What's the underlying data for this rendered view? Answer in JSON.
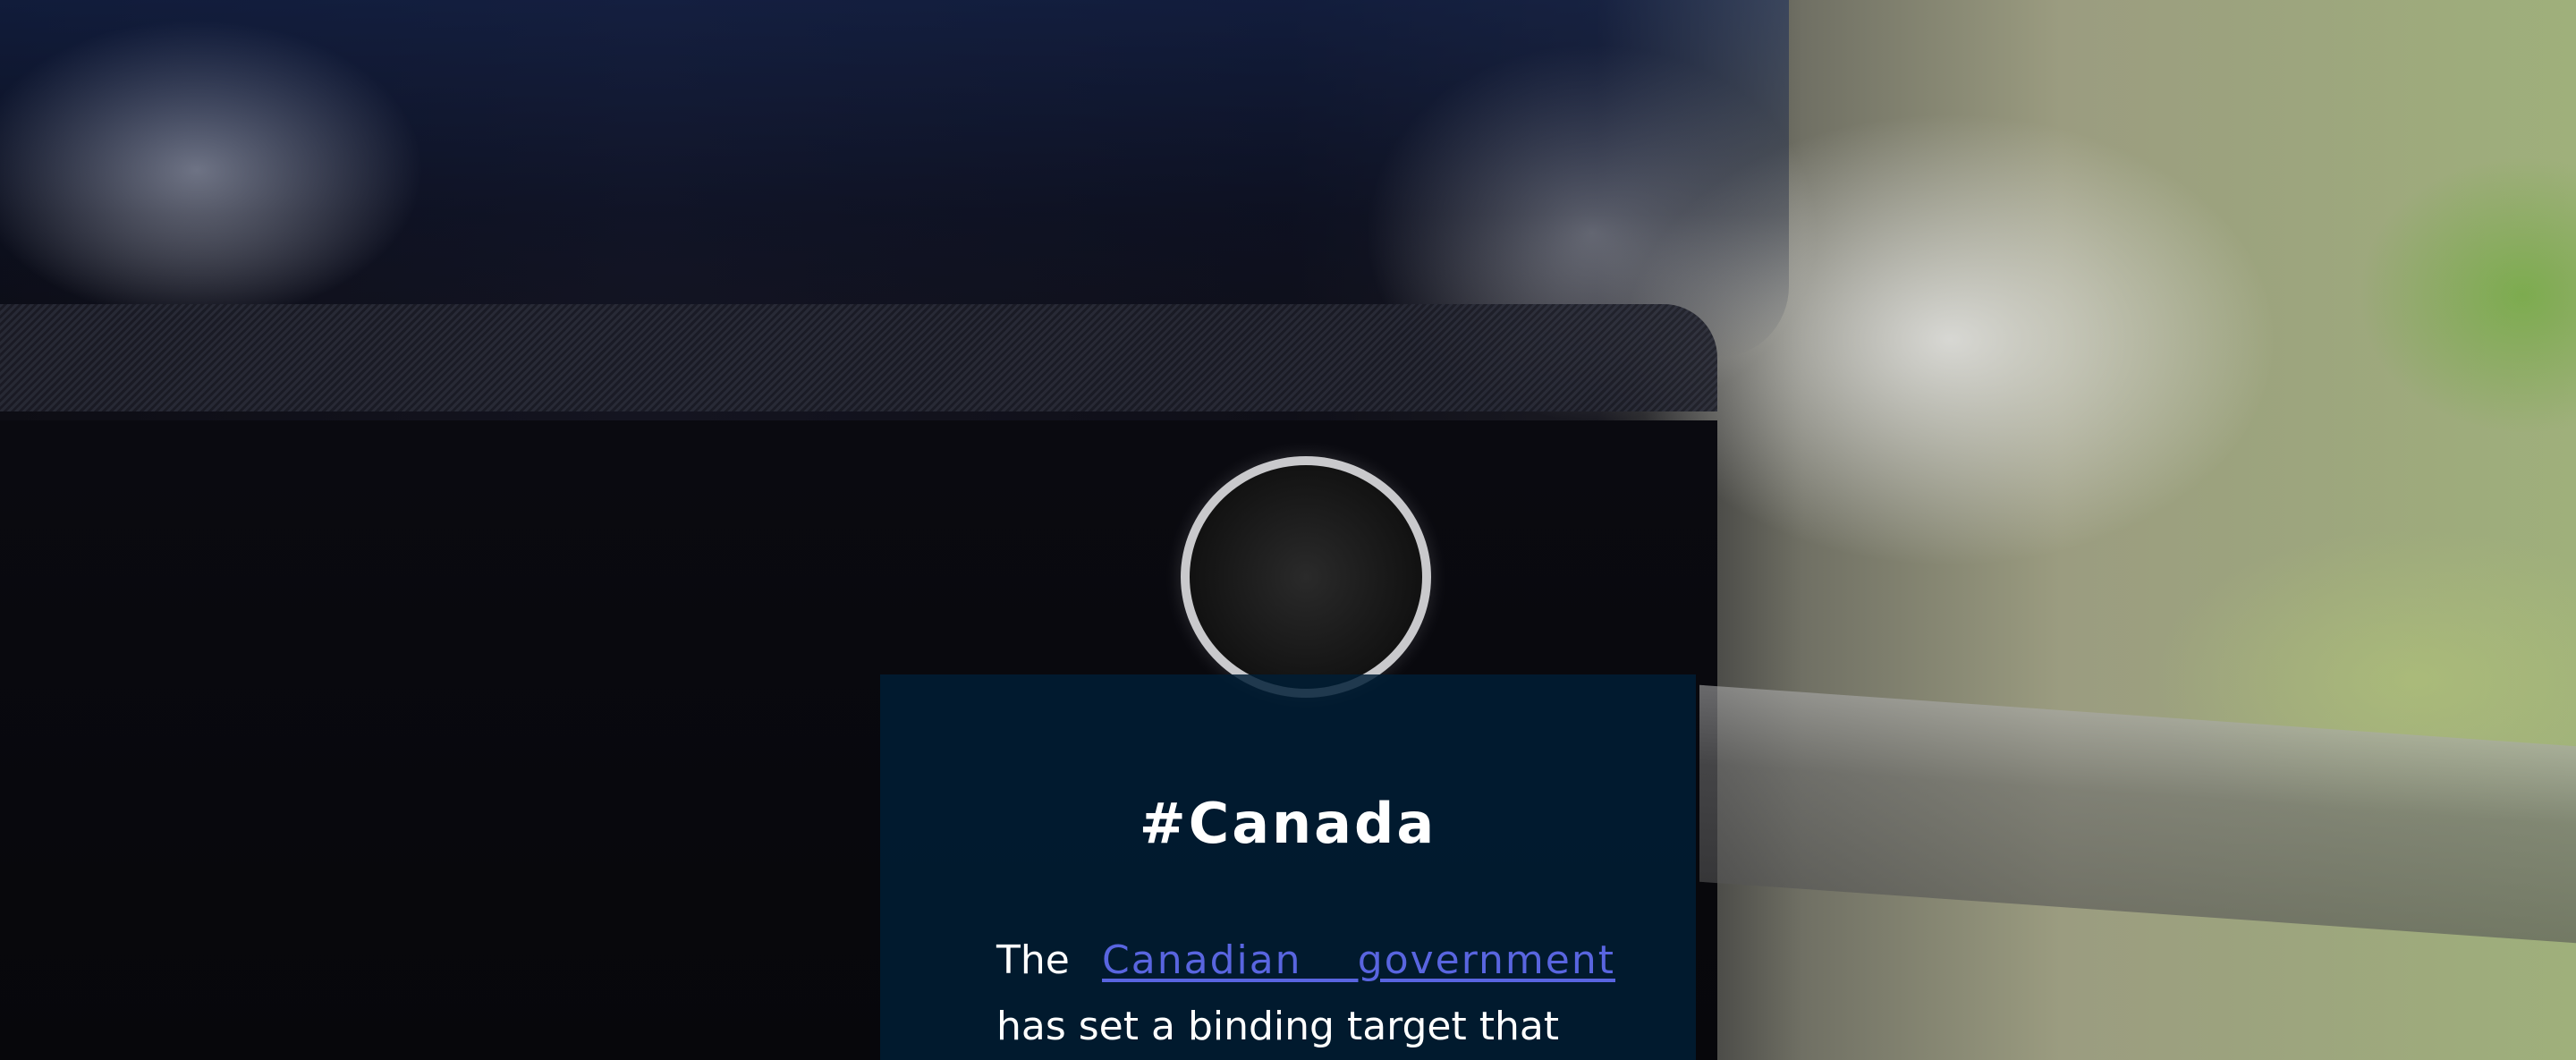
{
  "hero": {
    "image_alt": "car exhaust pipe with smoke"
  },
  "card": {
    "title": "#Canada",
    "text_before_link": "The ",
    "link_text": "Canadian government",
    "text_after_link": " has set a binding target that",
    "colors": {
      "card_background": "#001e36",
      "text": "#ffffff",
      "link": "#5965e0"
    }
  }
}
